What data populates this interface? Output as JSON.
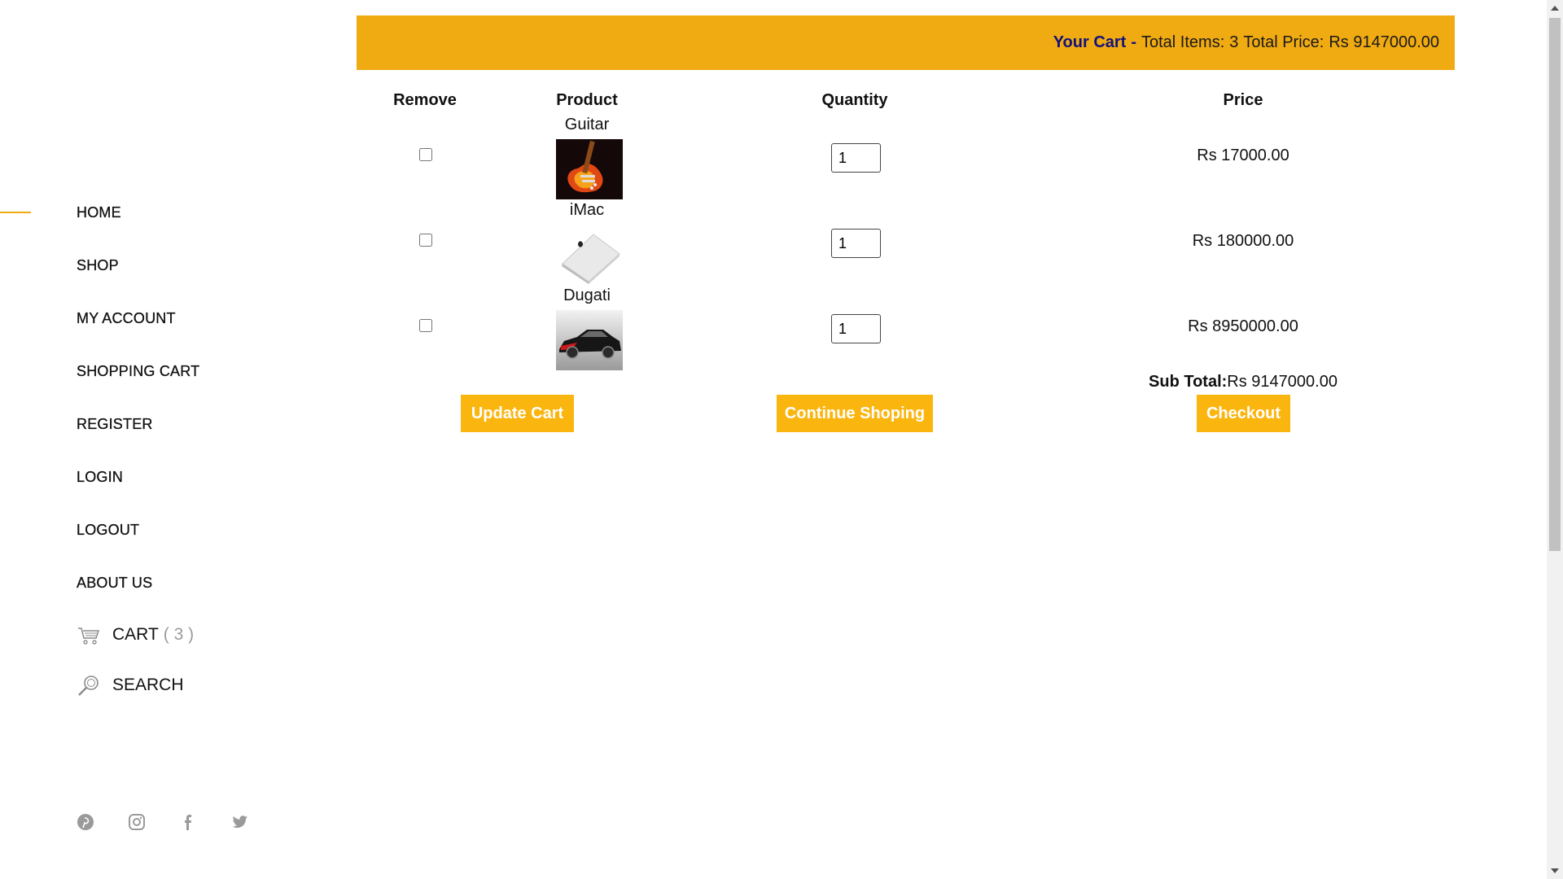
{
  "nav": {
    "items": [
      "HOME",
      "SHOP",
      "MY ACCOUNT",
      "SHOPPING CART",
      "REGISTER",
      "LOGIN",
      "LOGOUT",
      "ABOUT US"
    ],
    "active": "HOME",
    "cart_label": "CART",
    "cart_count": "( 3 )",
    "search_label": "SEARCH"
  },
  "social": [
    "pinterest-icon",
    "instagram-icon",
    "facebook-icon",
    "twitter-icon"
  ],
  "header": {
    "your_cart": "Your Cart",
    "separator": "-",
    "total_items_label": "Total Items:",
    "total_items": "3",
    "total_price_label": "Total Price:",
    "total_price": "Rs 9147000.00"
  },
  "table": {
    "columns": [
      "Remove",
      "Product",
      "Quantity",
      "Price"
    ],
    "rows": [
      {
        "product": "Guitar",
        "quantity": "1",
        "price": "Rs 17000.00",
        "image": "guitar-image"
      },
      {
        "product": "iMac",
        "quantity": "1",
        "price": "Rs 180000.00",
        "image": "laptop-image"
      },
      {
        "product": "Dugati",
        "quantity": "1",
        "price": "Rs 8950000.00",
        "image": "car-image"
      }
    ],
    "subtotal_label": "Sub Total:",
    "subtotal_value": "Rs 9147000.00"
  },
  "buttons": {
    "update": "Update Cart",
    "continue": "Continue Shoping",
    "checkout": "Checkout"
  },
  "colors": {
    "accent": "#f0aa12",
    "button": "#fbb50f",
    "header_title": "#13127a"
  }
}
